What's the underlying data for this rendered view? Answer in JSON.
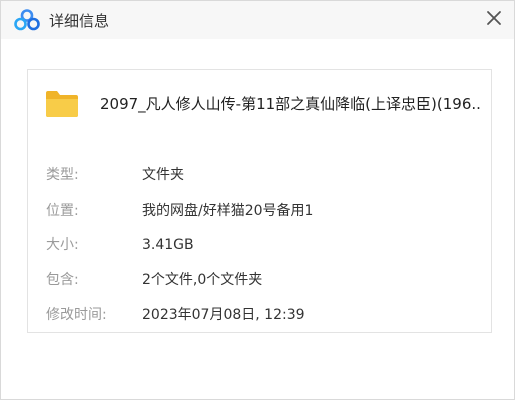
{
  "window": {
    "title": "详细信息",
    "close_icon": "close-icon",
    "app_icon": "baidu-netdisk-logo-icon"
  },
  "file": {
    "icon": "folder-icon",
    "name": "2097_凡人修人山传-第11部之真仙降临(上译忠臣)(196..."
  },
  "details": [
    {
      "label": "类型:",
      "value": "文件夹"
    },
    {
      "label": "位置:",
      "value": "我的网盘/好样猫20号备用1"
    },
    {
      "label": "大小:",
      "value": "3.41GB"
    },
    {
      "label": "包含:",
      "value": "2个文件,0个文件夹"
    },
    {
      "label": "修改时间:",
      "value": "2023年07月08日, 12:39"
    }
  ],
  "colors": {
    "logo_blue": "#2d8cf0",
    "folder_yellow": "#f5c13d",
    "label_gray": "#9a9a9a",
    "text_dark": "#333333"
  }
}
